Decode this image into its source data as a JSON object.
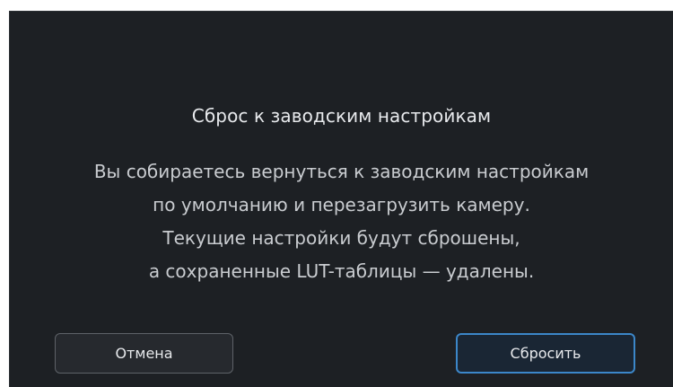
{
  "dialog": {
    "title": "Сброс к заводским настройкам",
    "message_lines": [
      "Вы собираетесь вернуться к заводским настройкам",
      "по умолчанию и перезагрузить камеру.",
      "Текущие настройки будут сброшены,",
      "а сохраненные LUT-таблицы — удалены."
    ],
    "buttons": {
      "cancel_label": "Отмена",
      "reset_label": "Сбросить"
    }
  },
  "colors": {
    "background": "#1d2024",
    "accent": "#3c87c9",
    "text": "#e8eaed"
  }
}
